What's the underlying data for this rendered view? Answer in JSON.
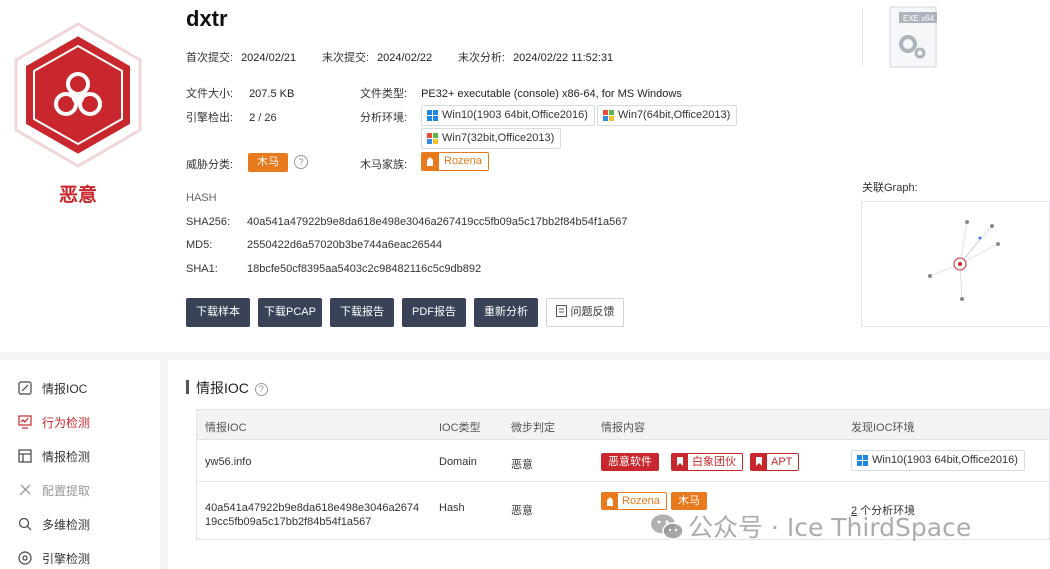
{
  "file": {
    "name": "dxtr",
    "verdict": "恶意",
    "first_submit_label": "首次提交:",
    "first_submit": "2024/02/21",
    "last_submit_label": "末次提交:",
    "last_submit": "2024/02/22",
    "last_analysis_label": "末次分析:",
    "last_analysis": "2024/02/22 11:52:31",
    "size_label": "文件大小:",
    "size": "207.5 KB",
    "type_label": "文件类型:",
    "type": "PE32+ executable (console) x86-64, for MS Windows",
    "engine_label": "引擎检出:",
    "engine_hits": "2",
    "engine_total": " / 26",
    "env_label": "分析环境:",
    "envs": [
      "Win10(1903 64bit,Office2016)",
      "Win7(64bit,Office2013)",
      "Win7(32bit,Office2013)"
    ],
    "threat_label": "威胁分类:",
    "threat": "木马",
    "family_label": "木马家族:",
    "family": "Rozena",
    "exe_badge": "EXE x64"
  },
  "hash": {
    "heading": "HASH",
    "sha256_label": "SHA256:",
    "sha256": "40a541a47922b9e8da618e498e3046a267419cc5fb09a5c17bb2f84b54f1a567",
    "md5_label": "MD5:",
    "md5": "2550422d6a57020b3be744a6eac26544",
    "sha1_label": "SHA1:",
    "sha1": "18bcfe50cf8395aa5403c2c98482116c5c9db892"
  },
  "actions": {
    "download_sample": "下载样本",
    "download_pcap": "下载PCAP",
    "download_report": "下载报告",
    "pdf_report": "PDF报告",
    "reanalyze": "重新分析",
    "feedback": "问题反馈"
  },
  "graph": {
    "label": "关联Graph:"
  },
  "sidebar": {
    "items": [
      {
        "label": "情报IOC",
        "icon": "edit-icon"
      },
      {
        "label": "行为检测",
        "icon": "monitor-icon"
      },
      {
        "label": "情报检测",
        "icon": "layout-icon"
      },
      {
        "label": "配置提取",
        "icon": "tools-icon"
      },
      {
        "label": "多维检测",
        "icon": "search-multi-icon"
      },
      {
        "label": "引擎检测",
        "icon": "engine-icon"
      }
    ]
  },
  "ioc": {
    "title": "情报IOC",
    "columns": [
      "情报IOC",
      "IOC类型",
      "微步判定",
      "情报内容",
      "发现IOC环境"
    ],
    "rows": [
      {
        "ioc": "yw56.info",
        "type": "Domain",
        "verdict": "恶意",
        "tags": [
          "恶意软件",
          "白象团伙",
          "APT"
        ],
        "env": "Win10(1903 64bit,Office2016)"
      },
      {
        "ioc_line1": "40a541a47922b9e8da618e498e3046a2674",
        "ioc_line2": "19cc5fb09a5c17bb2f84b54f1a567",
        "type": "Hash",
        "verdict": "恶意",
        "tags": [
          "Rozena",
          "木马"
        ],
        "env_count": "2",
        "env_text": " 个分析环境"
      }
    ]
  },
  "watermark": "公众号 · Ice ThirdSpace",
  "colors": {
    "malicious": "#c8282d",
    "trojan": "#e8791c",
    "button_dark": "#394256"
  }
}
